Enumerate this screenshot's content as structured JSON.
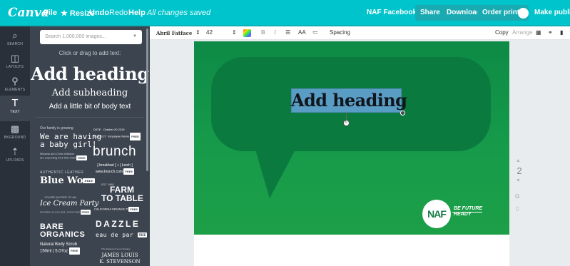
{
  "app": {
    "logo": "Canva"
  },
  "menu": {
    "file": "File",
    "resize": "Resize",
    "undo": "Undo",
    "redo": "Redo",
    "help": "Help",
    "status": "All changes saved"
  },
  "header": {
    "doc_title": "NAF Facebook Post",
    "share": "Share",
    "download": "Download",
    "order_prints": "Order prints",
    "make_public": "Make public"
  },
  "rail": [
    {
      "label": "SEARCH",
      "icon": "⌕"
    },
    {
      "label": "LAYOUTS",
      "icon": "◫"
    },
    {
      "label": "ELEMENTS",
      "icon": "⚲"
    },
    {
      "label": "TEXT",
      "icon": "T"
    },
    {
      "label": "BKGROUND",
      "icon": "▩"
    },
    {
      "label": "UPLOADS",
      "icon": "⇡"
    }
  ],
  "panel": {
    "search_placeholder": "Search 1,000,000 images...",
    "hint": "Click or drag to add text:",
    "add_heading": "Add heading",
    "add_subheading": "Add subheading",
    "add_body": "Add a little bit of body text",
    "templates": {
      "our_family": "Our family is growing",
      "date": "DATE",
      "date_value": "October 20 2019",
      "subject": "SUBJECT",
      "subject_value": "Employee Name",
      "baby_1": "We are having",
      "baby_2": "a baby girl!",
      "baby_small_1": "Mikaela and Chris Williams",
      "baby_small_2": "are expecting their first child",
      "brunch": "brunch",
      "brunch_sub": "[ breakfast ] + [ lunch ]",
      "brunch_url": "www.brunch.com",
      "authentic": "AUTHENTIC LEATHER",
      "blue_wo": "Blue Wo",
      "est": "EST 1985",
      "farm": "FARM",
      "to_table": "TO TABLE",
      "california": "CALIFORNIA ORGANIC P",
      "invited": "YOU'RE INVITED TO AN",
      "ice_cream": "Ice Cream Party",
      "saturday": "SATURDAY 14 JULY 2018 · DONUT BAR",
      "bare": "BARE",
      "organics": "ORGANICS",
      "dazzle": "DAZZLE",
      "eau": "eau de par",
      "natural_1": "Natural Body Scrub",
      "natural_2": "150ml | 5.07oz",
      "presence": "The pleasure of your company",
      "james": "JAMES LOUIS",
      "stevenson": "K. STEVENSON",
      "free": "FREE"
    }
  },
  "toolbar": {
    "font": "Abril Fatface",
    "size": "42",
    "bold": "B",
    "italic": "I",
    "uppercase": "AA",
    "spacing": "Spacing",
    "copy": "Copy",
    "arrange": "Arrange"
  },
  "canvas": {
    "heading": "Add heading",
    "naf": "NAF",
    "tag_1": "BE FUTURE",
    "tag_2": "READY",
    "page_number": "2"
  }
}
